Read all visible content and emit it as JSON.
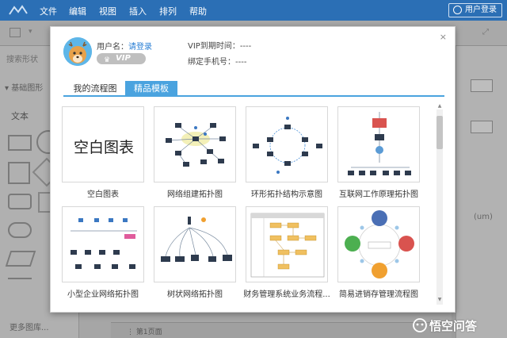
{
  "menubar": {
    "items": [
      "文件",
      "编辑",
      "视图",
      "插入",
      "排列",
      "帮助"
    ],
    "user_button": "用户登录"
  },
  "left_panel": {
    "search_placeholder": "搜索形状",
    "section_title": "基础图形",
    "text_shape": "文本",
    "more": "更多图库..."
  },
  "page_bar": {
    "page_tab": "第1页面"
  },
  "right_panel": {
    "unit": "(um)"
  },
  "modal": {
    "username_label": "用户名：",
    "username_link": "请登录",
    "vip_badge": "VIP",
    "vip_expiry_label": "VIP到期时间：----",
    "phone_label": "绑定手机号：----",
    "tabs": [
      {
        "label": "我的流程图",
        "active": false
      },
      {
        "label": "精品模板",
        "active": true
      }
    ],
    "blank_card_text": "空白图表",
    "templates": [
      {
        "label": "空白图表"
      },
      {
        "label": "网络组建拓扑图"
      },
      {
        "label": "环形拓扑结构示意图"
      },
      {
        "label": "互联网工作原理拓扑图"
      },
      {
        "label": "小型企业网络拓扑图"
      },
      {
        "label": "树状网络拓扑图"
      },
      {
        "label": "财务管理系统业务流程..."
      },
      {
        "label": "简易进销存管理流程图"
      }
    ],
    "close_glyph": "×"
  },
  "watermark": {
    "text": "悟空问答"
  },
  "colors": {
    "accent": "#4aa3df",
    "link": "#2a7fd4",
    "menubar": "#2b6fb5"
  }
}
